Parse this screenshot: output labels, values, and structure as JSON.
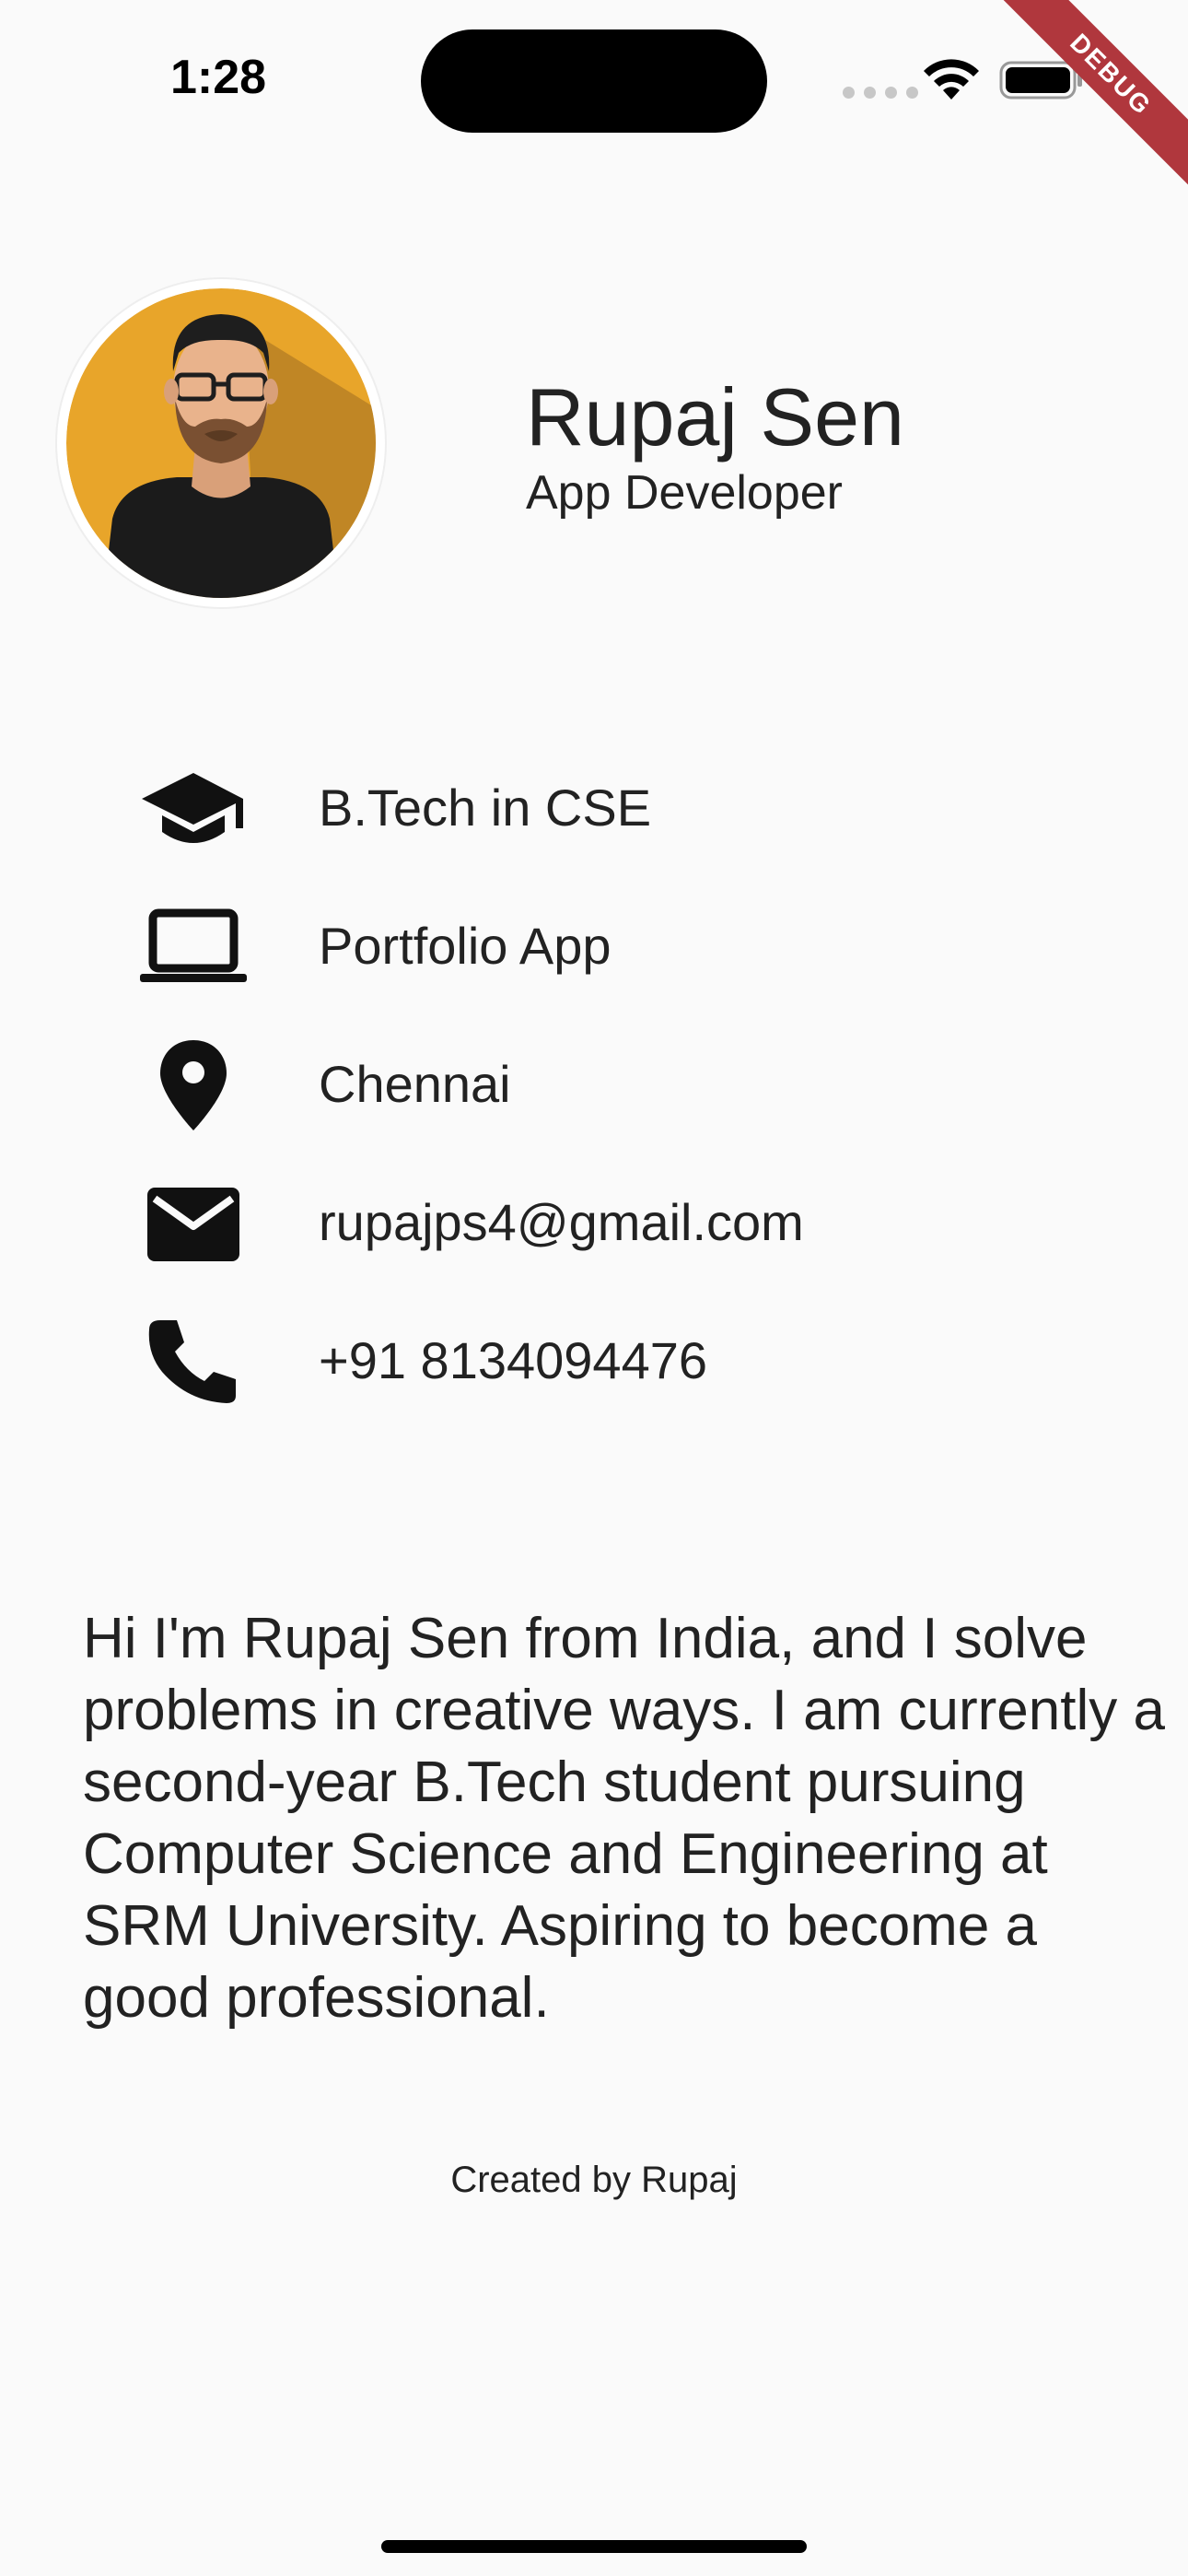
{
  "status_bar": {
    "time": "1:28"
  },
  "debug_banner": "DEBUG",
  "profile": {
    "name": "Rupaj Sen",
    "title": "App Developer"
  },
  "info_items": [
    {
      "icon": "graduation-cap-icon",
      "text": "B.Tech in CSE"
    },
    {
      "icon": "laptop-icon",
      "text": "Portfolio App"
    },
    {
      "icon": "location-pin-icon",
      "text": "Chennai"
    },
    {
      "icon": "email-icon",
      "text": "rupajps4@gmail.com"
    },
    {
      "icon": "phone-icon",
      "text": "+91 8134094476"
    }
  ],
  "bio": "Hi I'm Rupaj Sen from India, and I solve problems in creative ways. I am currently a second-year B.Tech student pursuing Computer Science and Engineering at SRM University. Aspiring to become a good professional.",
  "footer": "Created by Rupaj",
  "colors": {
    "background": "#fafafa",
    "avatar_bg": "#e8a52a",
    "text": "#222222",
    "debug_ribbon": "#b0373d"
  }
}
